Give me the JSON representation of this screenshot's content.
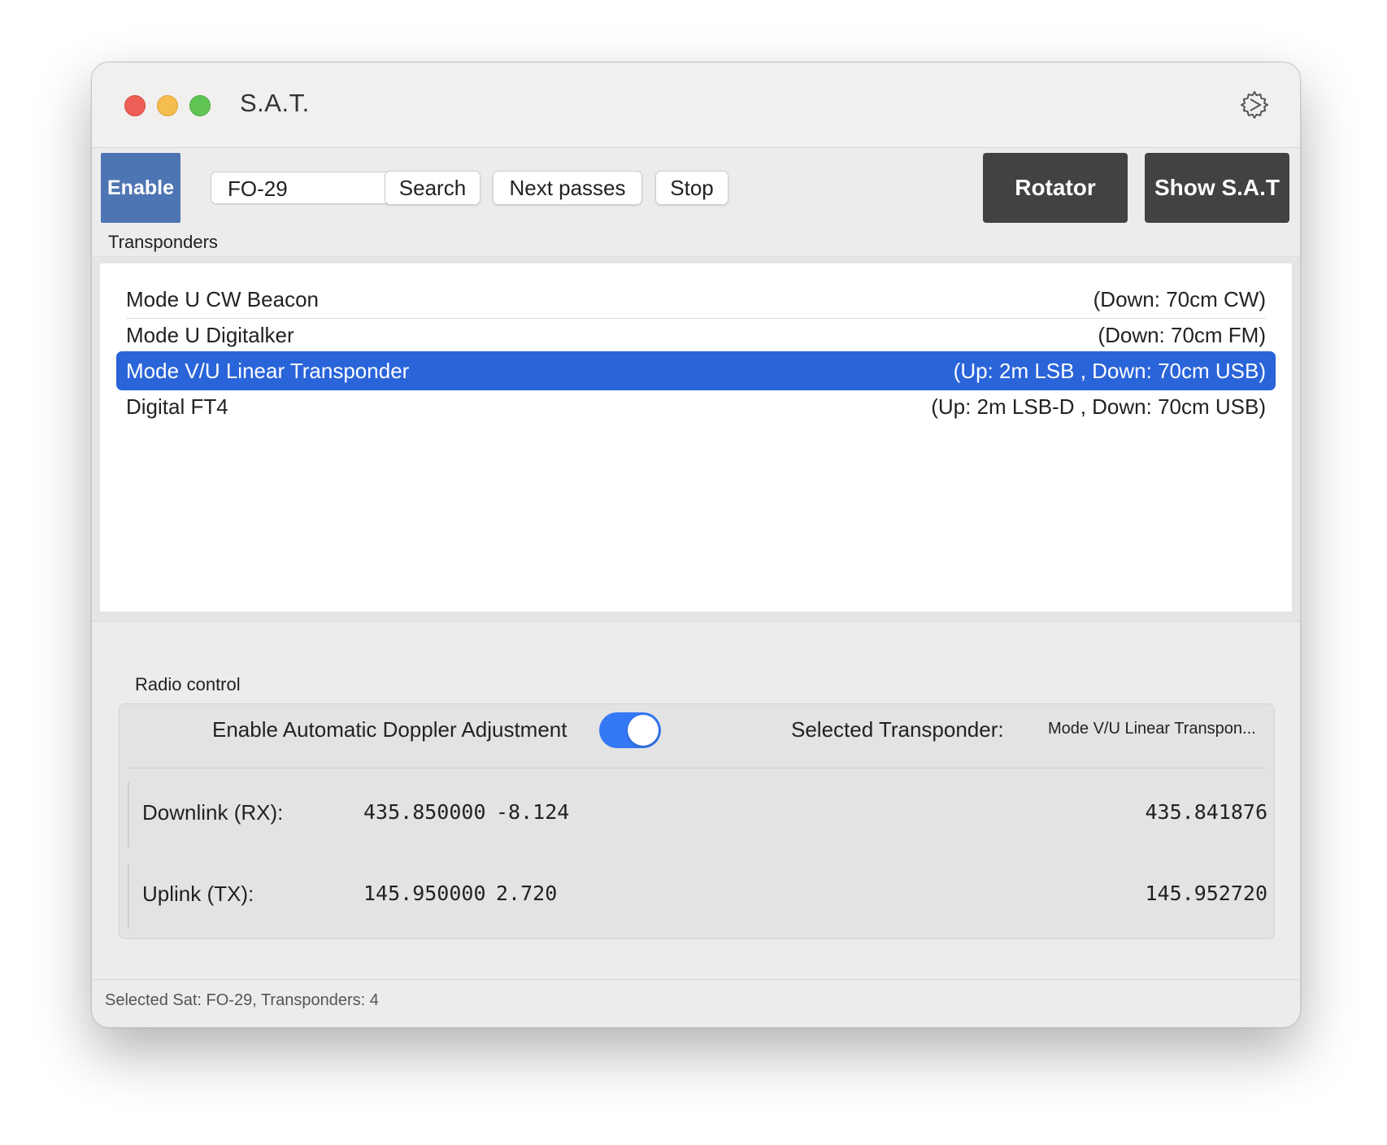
{
  "window": {
    "title": "S.A.T."
  },
  "toolbar": {
    "enable_label": "Enable",
    "satellite_value": "FO-29",
    "search_label": "Search",
    "next_passes_label": "Next passes",
    "stop_label": "Stop",
    "rotator_label": "Rotator",
    "show_sat_label": "Show S.A.T"
  },
  "transponders": {
    "section_label": "Transponders",
    "items": [
      {
        "name": "Mode U CW Beacon",
        "modes": "(Down: 70cm CW)",
        "selected": false
      },
      {
        "name": "Mode U Digitalker",
        "modes": "(Down: 70cm FM)",
        "selected": false
      },
      {
        "name": "Mode V/U Linear Transponder",
        "modes": "(Up: 2m LSB , Down: 70cm USB)",
        "selected": true
      },
      {
        "name": "Digital FT4",
        "modes": "(Up: 2m LSB-D , Down: 70cm USB)",
        "selected": false
      }
    ]
  },
  "radio_control": {
    "section_label": "Radio control",
    "doppler_label": "Enable Automatic Doppler Adjustment",
    "doppler_enabled": true,
    "selected_transponder_label": "Selected Transponder:",
    "selected_transponder_value": "Mode V/U Linear Transpon...",
    "downlink": {
      "label": "Downlink (RX):",
      "nominal": "435.850000",
      "shift": "-8.124",
      "result": "435.841876"
    },
    "uplink": {
      "label": "Uplink (TX):",
      "nominal": "145.950000",
      "shift": "2.720",
      "result": "145.952720"
    }
  },
  "status": {
    "text": "Selected Sat: FO-29, Transponders: 4"
  },
  "colors": {
    "enable_button": "#4e75b3",
    "selection": "#2a64d9",
    "toggle_on": "#3478f6",
    "dark_button": "#424242"
  }
}
